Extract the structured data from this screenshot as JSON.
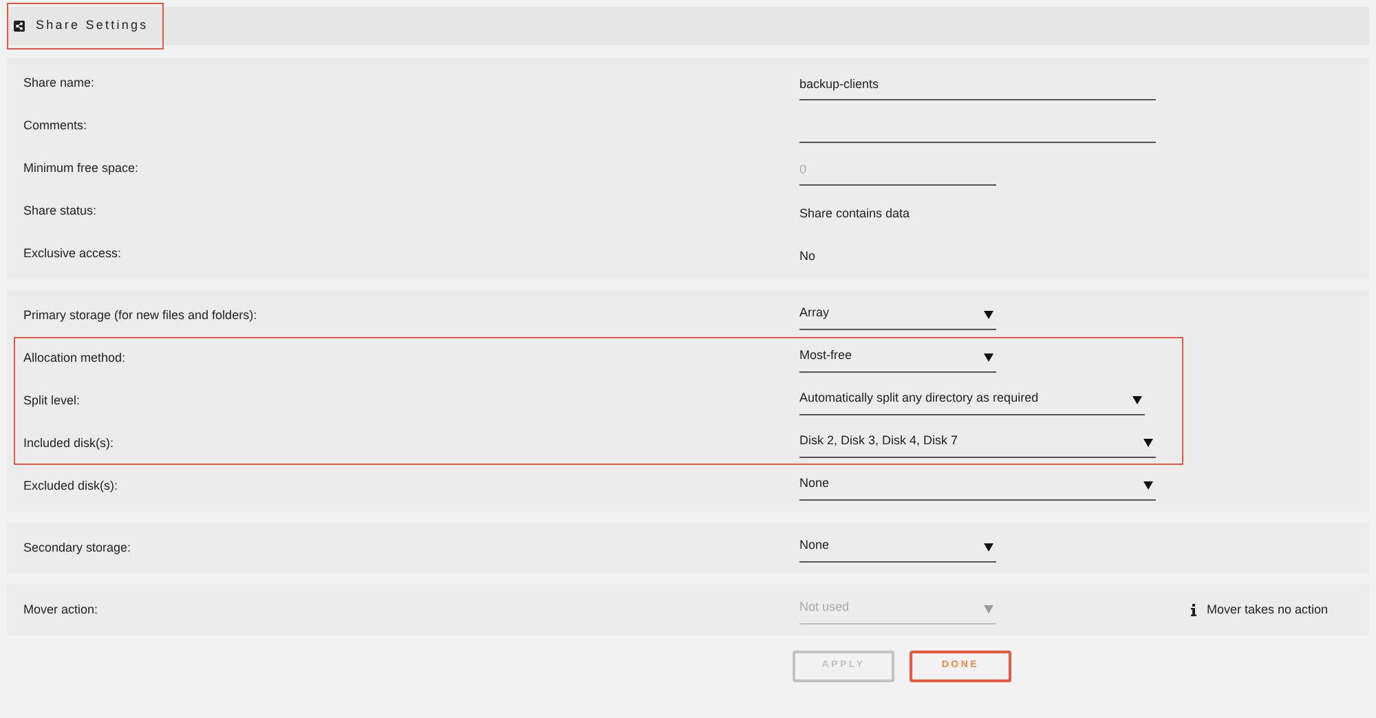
{
  "header": {
    "title": "Share Settings",
    "highlighted": true
  },
  "sections": [
    {
      "rows": [
        {
          "label": "Share name:",
          "kind": "text",
          "value": "backup-clients",
          "highlighted": false
        },
        {
          "label": "Comments:",
          "kind": "text",
          "highlighted": false
        },
        {
          "label": "Minimum free space:",
          "kind": "text",
          "placeholder": "0",
          "highlighted": false
        },
        {
          "label": "Share status:",
          "kind": "static",
          "value": "Share contains data",
          "highlighted": false
        },
        {
          "label": "Exclusive access:",
          "kind": "static",
          "value": "No",
          "highlighted": false
        }
      ]
    },
    {
      "rows": [
        {
          "label": "Primary storage (for new files and folders):",
          "kind": "select",
          "value": "Array",
          "disabled": false,
          "highlighted": false
        },
        {
          "label": "Allocation method:",
          "kind": "select",
          "value": "Most-free",
          "disabled": false,
          "highlighted": true
        },
        {
          "label": "Split level:",
          "kind": "select",
          "value": "Automatically split any directory as required",
          "disabled": false,
          "highlighted": true
        },
        {
          "label": "Included disk(s):",
          "kind": "select",
          "value": "Disk 2, Disk 3, Disk 4, Disk 7",
          "disabled": false,
          "highlighted": true
        },
        {
          "label": "Excluded disk(s):",
          "kind": "select",
          "value": "None",
          "disabled": false,
          "highlighted": false
        }
      ]
    },
    {
      "rows": [
        {
          "label": "Secondary storage:",
          "kind": "select",
          "value": "None",
          "disabled": false,
          "highlighted": false
        }
      ]
    },
    {
      "rows": [
        {
          "label": "Mover action:",
          "kind": "select",
          "value": "Not used",
          "disabled": true,
          "highlighted": false,
          "note": "Mover takes no action"
        }
      ]
    }
  ],
  "buttons": [
    {
      "label": "APPLY",
      "kind": "apply",
      "disabled": true
    },
    {
      "label": "DONE",
      "kind": "done",
      "disabled": false
    }
  ]
}
